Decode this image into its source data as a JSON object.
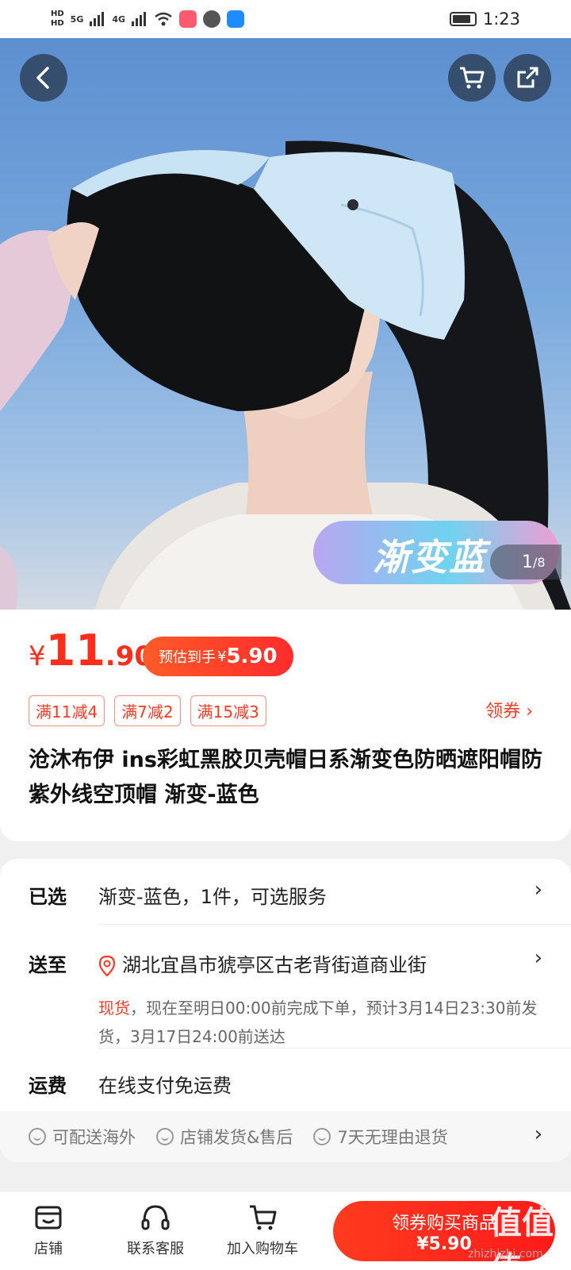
{
  "status_bar": {
    "time": "1:23",
    "network_1": "5G",
    "network_2": "4G"
  },
  "hero": {
    "badge_text": "渐变蓝",
    "page_current": "1",
    "page_total": "/8"
  },
  "price": {
    "currency": "¥",
    "integer": "11",
    "decimal": ".90"
  },
  "estimate": {
    "label": "预估到手",
    "currency": "¥",
    "amount": "5.90"
  },
  "coupons": [
    "满11减4",
    "满7减2",
    "满15减3"
  ],
  "get_coupon": "领券 ›",
  "title": "沧沐布伊  ins彩虹黑胶贝壳帽日系渐变色防晒遮阳帽防紫外线空顶帽 渐变-蓝色",
  "selected": {
    "label": "已选",
    "value": "渐变-蓝色，1件，可选服务"
  },
  "ship_to": {
    "label": "送至",
    "address": "湖北宜昌市猇亭区古老背街道商业街",
    "stock": "现货",
    "delivery": "，现在至明日00:00前完成下单，预计3月14日23:30前发货，3月17日24:00前送达"
  },
  "freight": {
    "label": "运费",
    "value": "在线支付免运费"
  },
  "services": [
    "可配送海外",
    "店铺发货&售后",
    "7天无理由退货"
  ],
  "bottom_nav": {
    "shop": "店铺",
    "service": "联系客服",
    "add_cart": "加入购物车"
  },
  "buy": {
    "line1": "领券购买商品",
    "line2": "¥5.90"
  },
  "watermark": {
    "text": "值值值",
    "url": "zhizhizhi.com"
  }
}
